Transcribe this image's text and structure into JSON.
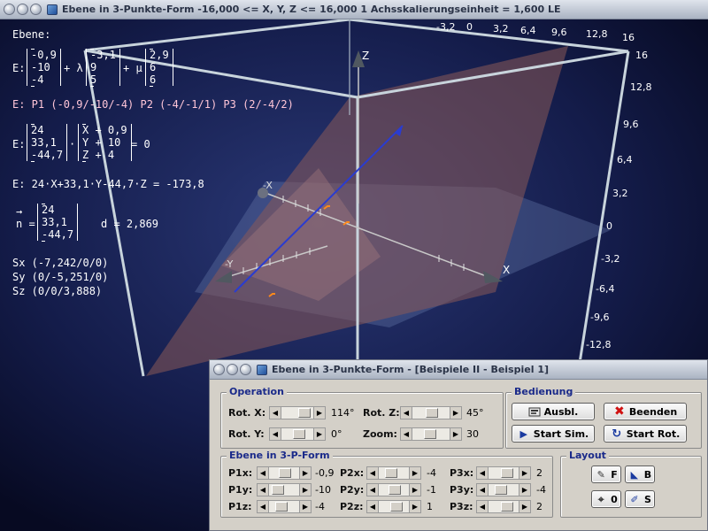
{
  "main_window": {
    "title": "Ebene in 3-Punkte-Form   -16,000 <= X, Y, Z <= 16,000   1 Achsskalierungseinheit = 1,600 LE"
  },
  "overlay": {
    "heading": "Ebene:",
    "param_form": {
      "e_label": "E:",
      "v1": [
        "-0,9",
        "-10",
        "-4"
      ],
      "plus_lambda": "+ λ",
      "v2": [
        "-3,1",
        "9",
        "5"
      ],
      "plus_mu": "+ μ",
      "v3": [
        "2,9",
        "6",
        "6"
      ]
    },
    "points_line": "E: P1 (-0,9/-10/-4)   P2 (-4/-1/1)   P3 (2/-4/2)",
    "normal_form": {
      "e_label": "E:",
      "n": [
        "24",
        "33,1",
        "-44,7"
      ],
      "dot": "·",
      "x_minus_p": [
        "X + 0,9",
        "Y + 10",
        "Z + 4"
      ],
      "equals": "= 0"
    },
    "coord_form": "E: 24·X+33,1·Y-44,7·Z = -173,8",
    "normal_vector": {
      "arrow": "→",
      "label": "n =",
      "values": [
        "24",
        "33,1",
        "-44,7"
      ],
      "distance": "d = 2,869"
    },
    "intercepts": [
      "Sx (-7,242/0/0)",
      "Sy (0/-5,251/0)",
      "Sz (0/0/3,888)"
    ]
  },
  "axes": {
    "x_label": "X",
    "y_label": "Y",
    "z_label": "Z",
    "neg_x_label": "-X",
    "neg_y_label": "-Y",
    "top_ticks": [
      "-3,2",
      "0",
      "3,2",
      "6,4",
      "9,6",
      "12,8",
      "16"
    ],
    "right_ticks": [
      "16",
      "12,8",
      "9,6",
      "6,4",
      "3,2",
      "0",
      "-3,2",
      "-6,4",
      "-9,6",
      "-12,8"
    ]
  },
  "dialog": {
    "title": "Ebene in 3-Punkte-Form - [Beispiele II - Beispiel 1]",
    "operation": {
      "title": "Operation",
      "rot_x_label": "Rot. X:",
      "rot_x_value": "114°",
      "rot_z_label": "Rot. Z:",
      "rot_z_value": "45°",
      "rot_y_label": "Rot. Y:",
      "rot_y_value": "0°",
      "zoom_label": "Zoom:",
      "zoom_value": "30"
    },
    "bedienung": {
      "title": "Bedienung",
      "ausbl_label": "Ausbl.",
      "beenden_label": "Beenden",
      "start_sim_label": "Start Sim.",
      "start_rot_label": "Start Rot."
    },
    "ebene": {
      "title": "Ebene in 3-P-Form",
      "p1x_label": "P1x:",
      "p1x_value": "-0,9",
      "p1y_label": "P1y:",
      "p1y_value": "-10",
      "p1z_label": "P1z:",
      "p1z_value": "-4",
      "p2x_label": "P2x:",
      "p2x_value": "-4",
      "p2y_label": "P2y:",
      "p2y_value": "-1",
      "p2z_label": "P2z:",
      "p2z_value": "1",
      "p3x_label": "P3x:",
      "p3x_value": "2",
      "p3y_label": "P3y:",
      "p3y_value": "-4",
      "p3z_label": "P3z:",
      "p3z_value": "2"
    },
    "layout": {
      "title": "Layout",
      "f_label": "F",
      "b_label": "B",
      "zero_label": "0",
      "s_label": "S"
    }
  },
  "colors": {
    "background": "#0c1233",
    "plane_fill": "#8a5a58",
    "box_lines": "#c8d4dc",
    "normal_line": "#2a3cd0",
    "label_pink": "#ffc6d8"
  }
}
